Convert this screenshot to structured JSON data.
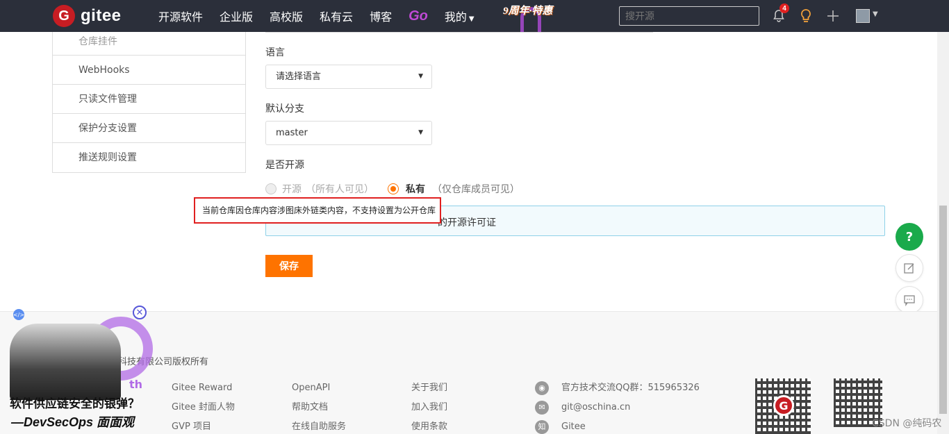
{
  "topnav": {
    "logo_letter": "G",
    "logo_text": "gitee",
    "items": [
      "开源软件",
      "企业版",
      "高校版",
      "私有云",
      "博客"
    ],
    "go_label": "Go",
    "mine_label": "我的",
    "anniversary_label": "9周年·特惠",
    "search_placeholder": "搜开源",
    "notification_count": "4"
  },
  "sidebar": {
    "items": [
      "仓库挂件",
      "WebHooks",
      "只读文件管理",
      "保护分支设置",
      "推送规则设置"
    ]
  },
  "form": {
    "language_label": "语言",
    "language_value": "请选择语言",
    "branch_label": "默认分支",
    "branch_value": "master",
    "open_source_label": "是否开源",
    "radio_public": "开源",
    "radio_public_hint": "（所有人可见）",
    "radio_private": "私有",
    "radio_private_hint": "（仅仓库成员可见）",
    "private_selected": true,
    "tooltip": "当前仓库因仓库内容涉图床外链类内容，不支持设置为公开仓库",
    "info_text": "的开源许可证",
    "save_label": "保存"
  },
  "floating": {
    "help": "?"
  },
  "footer": {
    "copyright": "科技有限公司版权所有",
    "col1": [
      "Gitee Reward",
      "Gitee 封面人物",
      "GVP 项目"
    ],
    "col2": [
      "OpenAPI",
      "帮助文档",
      "在线自助服务"
    ],
    "col3": [
      "关于我们",
      "加入我们",
      "使用条款"
    ],
    "contacts": [
      {
        "icon": "qq-icon",
        "text": "官方技术交流QQ群：515965326"
      },
      {
        "icon": "mail-icon",
        "text": "git@oschina.cn"
      },
      {
        "icon": "zhihu-icon",
        "glyph": "知",
        "text": "Gitee"
      }
    ],
    "watermark": "CSDN @纯码农"
  },
  "ad": {
    "line1": "软件供应链安全的银弹？",
    "line2": "—DevSecOps 面面观",
    "fragment": "th"
  }
}
